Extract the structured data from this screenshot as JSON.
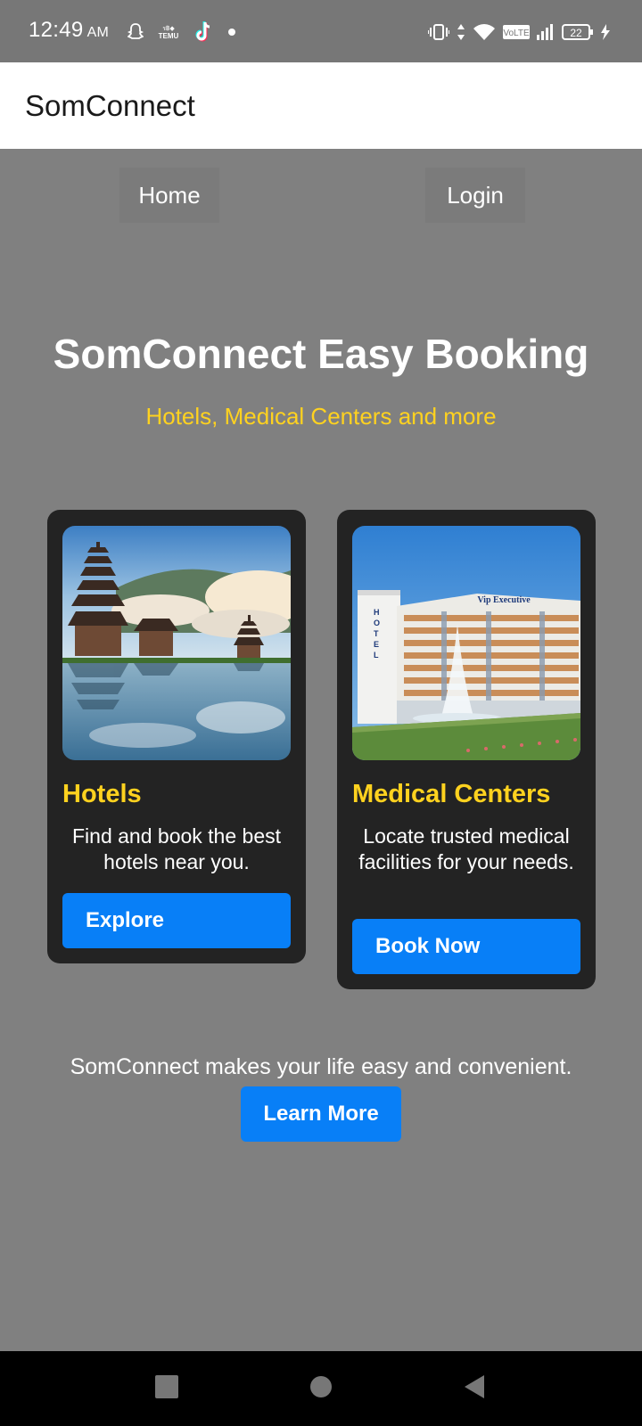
{
  "status_bar": {
    "time": "12:49",
    "ampm": "AM",
    "temu_label": "TEMU",
    "volte_label": "VoLTE",
    "battery": "22",
    "icons": [
      "snapchat-icon",
      "temu-icon",
      "tiktok-icon",
      "dot-icon",
      "vibrate-icon",
      "data-arrows-icon",
      "wifi-icon",
      "volte-icon",
      "signal-icon",
      "battery-icon",
      "charging-icon"
    ]
  },
  "app_bar": {
    "title": "SomConnect"
  },
  "nav": {
    "home": "Home",
    "login": "Login"
  },
  "hero": {
    "title": "SomConnect Easy Booking",
    "subtitle": "Hotels, Medical Centers and more"
  },
  "cards": [
    {
      "title": "Hotels",
      "description": "Find and book the best hotels near you.",
      "button": "Explore",
      "image": "pagoda-lake-image"
    },
    {
      "title": "Medical Centers",
      "description": "Locate trusted medical facilities for your needs.",
      "button": "Book Now",
      "image": "hotel-building-image",
      "sign_text": "Vip Executive",
      "vertical_sign": "HOTEL"
    }
  ],
  "footer": {
    "text": "SomConnect makes your life easy and convenient.",
    "button": "Learn More"
  },
  "colors": {
    "accent_blue": "#087ff7",
    "accent_yellow": "#ffd21f",
    "card_bg": "#232323",
    "page_bg": "#808080"
  },
  "system_nav": {
    "buttons": [
      "recents-button",
      "home-button",
      "back-button"
    ]
  }
}
